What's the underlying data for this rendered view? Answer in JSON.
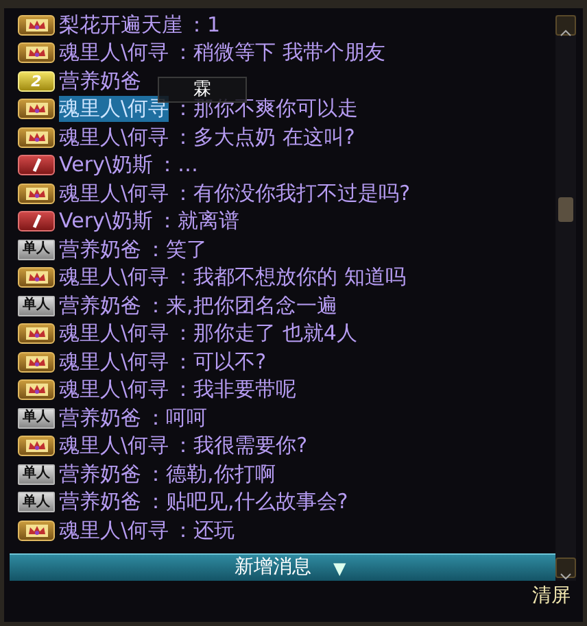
{
  "messages": [
    {
      "badge": {
        "kind": "crown"
      },
      "name": "梨花开遍天崖",
      "sep": "：",
      "text": "1",
      "selected": false
    },
    {
      "badge": {
        "kind": "crown"
      },
      "name": "魂里人\\何寻",
      "sep": "：",
      "text": "稍微等下 我带个朋友",
      "selected": false
    },
    {
      "badge": {
        "kind": "number",
        "label": "2"
      },
      "name": "营养奶爸",
      "selected": false
    },
    {
      "badge": {
        "kind": "crown"
      },
      "name": "魂里人\\何寻",
      "sep": "：",
      "text": "那你不爽你可以走",
      "selected": true
    },
    {
      "badge": {
        "kind": "crown"
      },
      "name": "魂里人\\何寻",
      "sep": "：",
      "text": "多大点奶 在这叫?",
      "selected": false
    },
    {
      "badge": {
        "kind": "slash"
      },
      "name": "Very\\奶斯",
      "sep": "：",
      "text": "…",
      "selected": false
    },
    {
      "badge": {
        "kind": "crown"
      },
      "name": "魂里人\\何寻",
      "sep": "：",
      "text": "有你没你我打不过是吗?",
      "selected": false
    },
    {
      "badge": {
        "kind": "slash"
      },
      "name": "Very\\奶斯",
      "sep": "：",
      "text": "就离谱",
      "selected": false
    },
    {
      "badge": {
        "kind": "solo",
        "label": "单人"
      },
      "name": "营养奶爸",
      "sep": "：",
      "text": "笑了",
      "selected": false
    },
    {
      "badge": {
        "kind": "crown"
      },
      "name": "魂里人\\何寻",
      "sep": "：",
      "text": "我都不想放你的 知道吗",
      "selected": false
    },
    {
      "badge": {
        "kind": "solo",
        "label": "单人"
      },
      "name": "营养奶爸",
      "sep": "：",
      "text": "来,把你团名念一遍",
      "selected": false
    },
    {
      "badge": {
        "kind": "crown"
      },
      "name": "魂里人\\何寻",
      "sep": "：",
      "text": "那你走了 也就4人",
      "selected": false
    },
    {
      "badge": {
        "kind": "crown"
      },
      "name": "魂里人\\何寻",
      "sep": "：",
      "text": "可以不?",
      "selected": false
    },
    {
      "badge": {
        "kind": "crown"
      },
      "name": "魂里人\\何寻",
      "sep": "：",
      "text": "我非要带呢",
      "selected": false
    },
    {
      "badge": {
        "kind": "solo",
        "label": "单人"
      },
      "name": "营养奶爸",
      "sep": "：",
      "text": "呵呵",
      "selected": false
    },
    {
      "badge": {
        "kind": "crown"
      },
      "name": "魂里人\\何寻",
      "sep": "：",
      "text": "我很需要你?",
      "selected": false
    },
    {
      "badge": {
        "kind": "solo",
        "label": "单人"
      },
      "name": "营养奶爸",
      "sep": "：",
      "text": "德勒,你打啊",
      "selected": false
    },
    {
      "badge": {
        "kind": "solo",
        "label": "单人"
      },
      "name": "营养奶爸",
      "sep": "：",
      "text": "贴吧见,什么故事会?",
      "selected": false
    },
    {
      "badge": {
        "kind": "crown"
      },
      "name": "魂里人\\何寻",
      "sep": "：",
      "text": "还玩",
      "selected": false
    }
  ],
  "tooltip": {
    "text": "霖"
  },
  "new_messages_bar": {
    "label": "新增消息",
    "arrow": "▼"
  },
  "clear_button": "清屏"
}
